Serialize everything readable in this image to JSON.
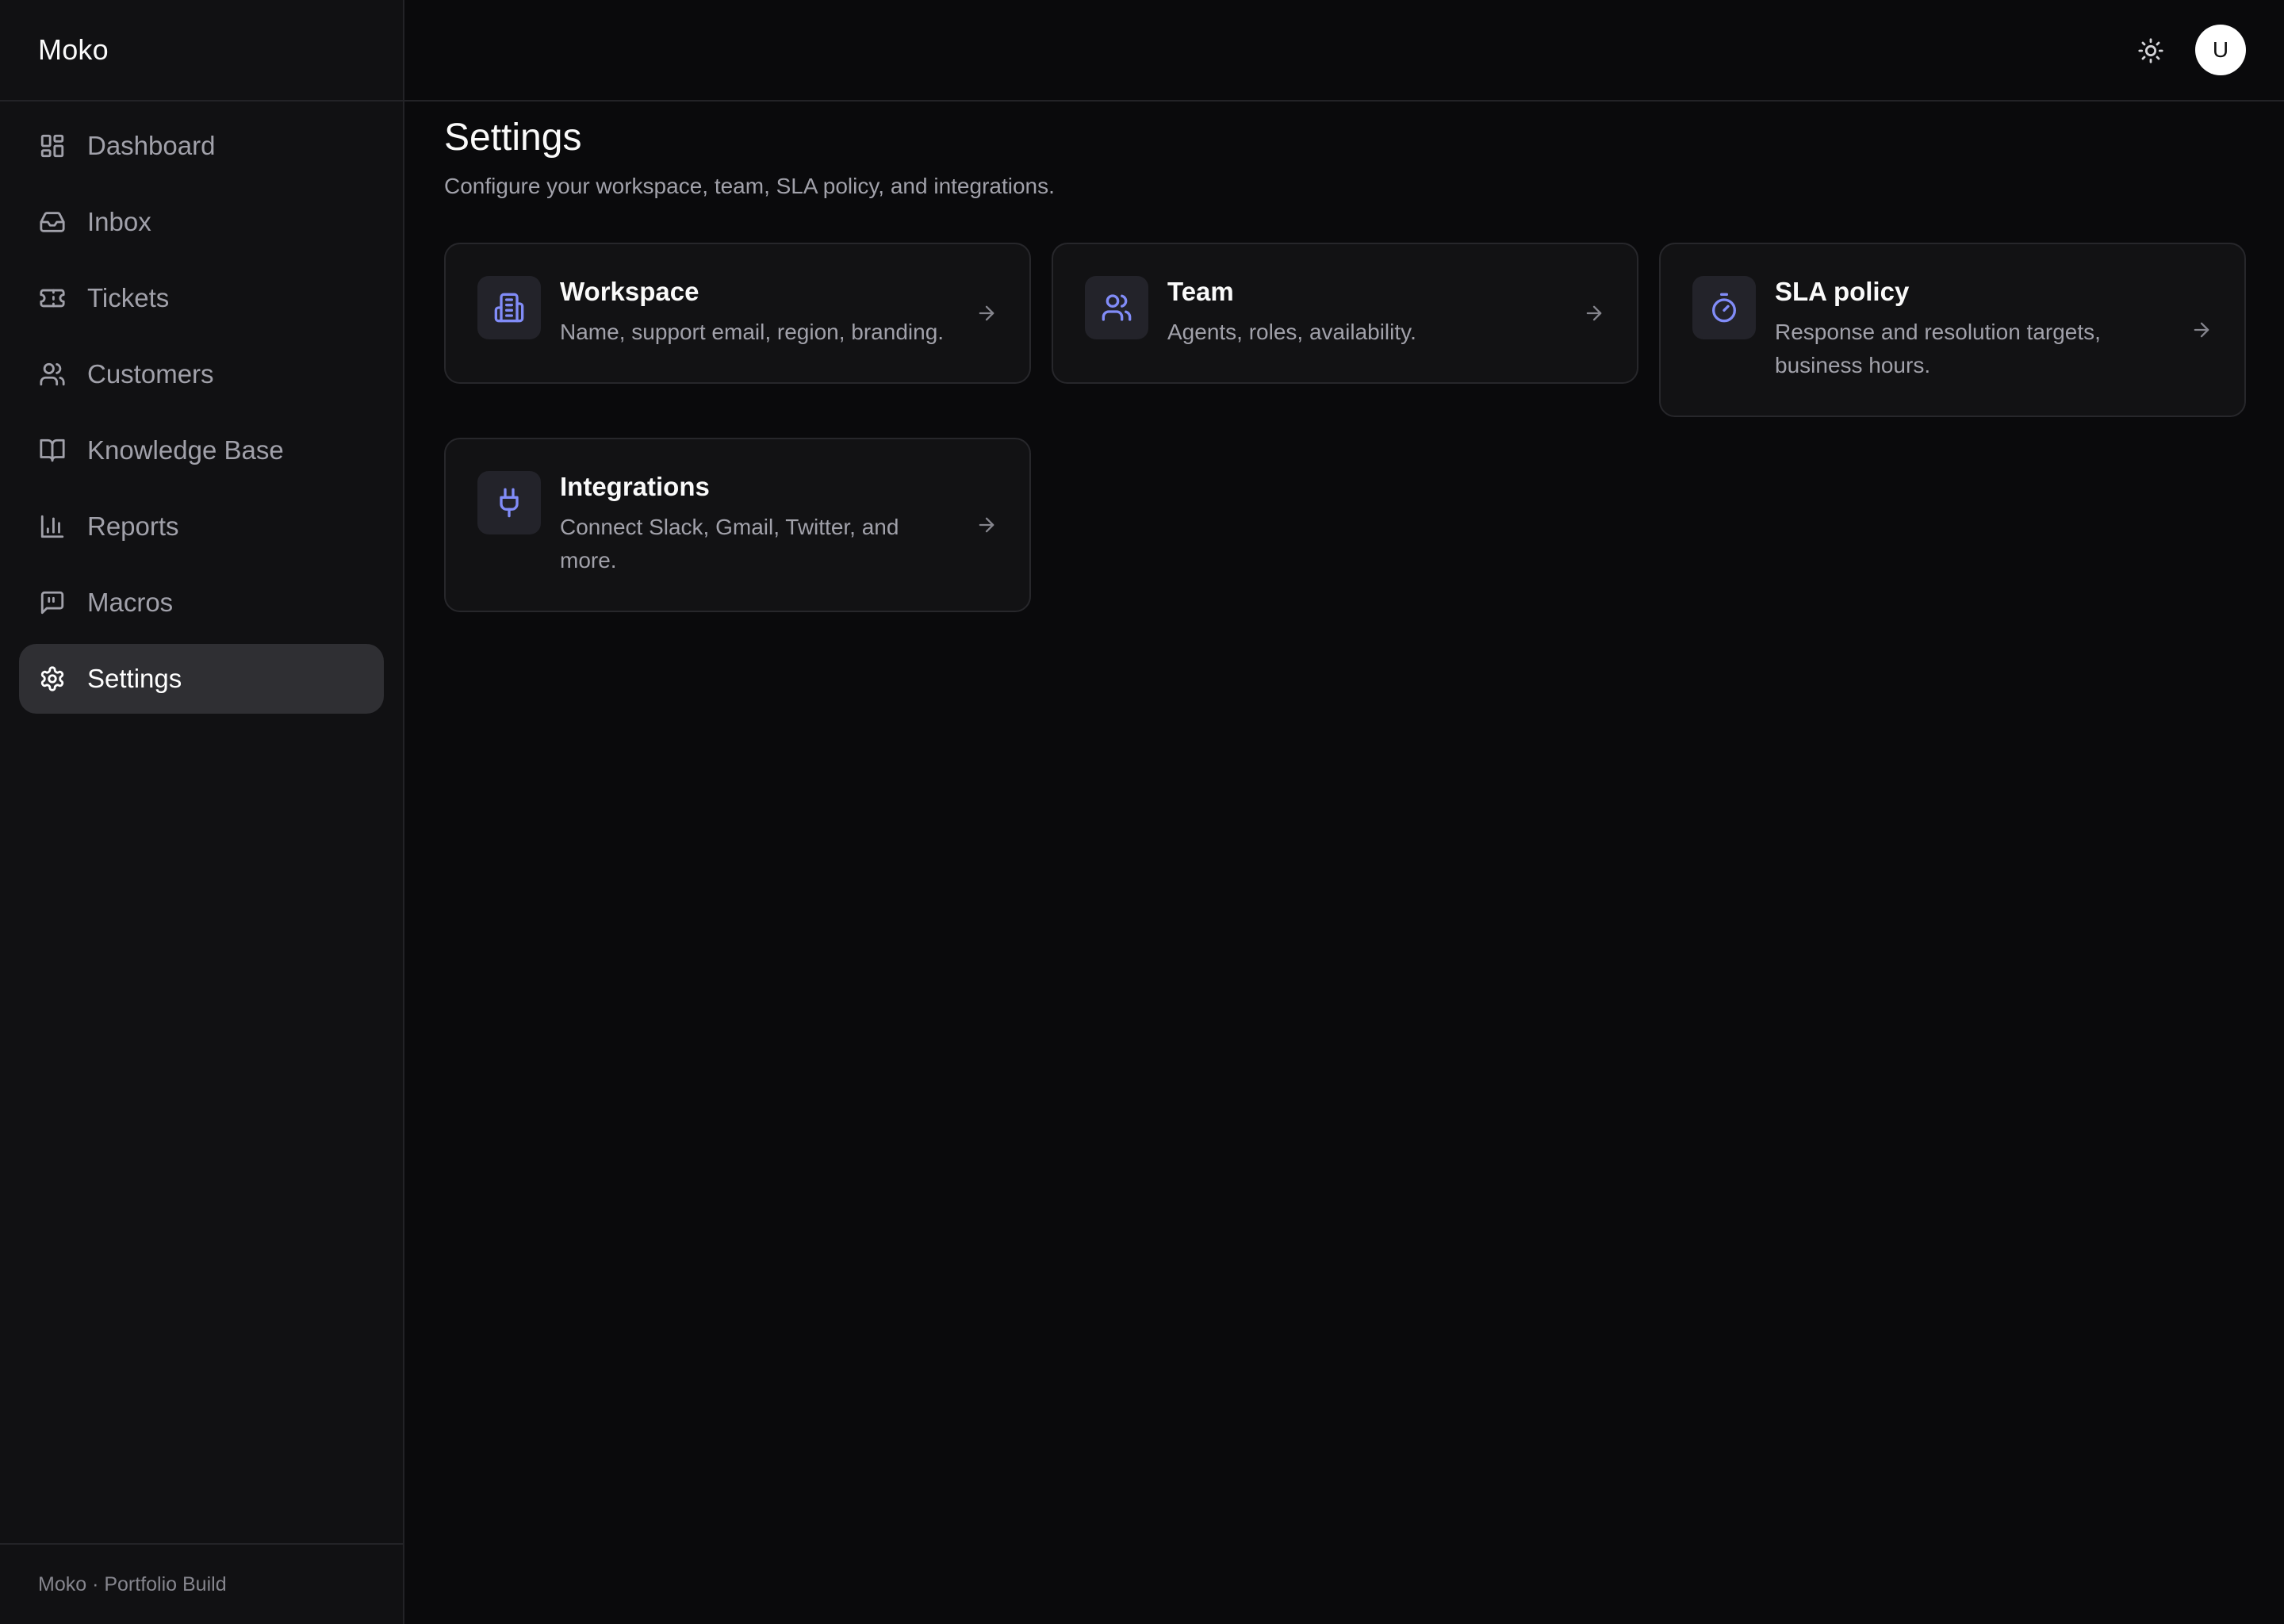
{
  "app": {
    "brand": "Moko"
  },
  "sidebar": {
    "items": [
      {
        "label": "Dashboard",
        "icon": "dashboard-icon",
        "active": false
      },
      {
        "label": "Inbox",
        "icon": "inbox-icon",
        "active": false
      },
      {
        "label": "Tickets",
        "icon": "ticket-icon",
        "active": false
      },
      {
        "label": "Customers",
        "icon": "users-icon",
        "active": false
      },
      {
        "label": "Knowledge Base",
        "icon": "book-icon",
        "active": false
      },
      {
        "label": "Reports",
        "icon": "bar-chart-icon",
        "active": false
      },
      {
        "label": "Macros",
        "icon": "message-quote-icon",
        "active": false
      },
      {
        "label": "Settings",
        "icon": "gear-icon",
        "active": true
      }
    ],
    "footer": "Moko · Portfolio Build"
  },
  "header": {
    "theme_toggle_icon": "sun-icon",
    "avatar_initial": "U"
  },
  "page": {
    "title": "Settings",
    "subtitle": "Configure your workspace, team, SLA policy, and integrations."
  },
  "cards": [
    {
      "title": "Workspace",
      "description": "Name, support email, region, branding.",
      "icon": "building-icon"
    },
    {
      "title": "Team",
      "description": "Agents, roles, availability.",
      "icon": "users-icon"
    },
    {
      "title": "SLA policy",
      "description": "Response and resolution targets, business hours.",
      "icon": "timer-icon"
    },
    {
      "title": "Integrations",
      "description": "Connect Slack, Gmail, Twitter, and more.",
      "icon": "plug-icon"
    }
  ],
  "colors": {
    "background": "#0a0a0c",
    "sidebar": "#111113",
    "active_item": "#2f2f33",
    "accent_icon": "#818cf8",
    "muted_text": "#a1a1aa"
  }
}
